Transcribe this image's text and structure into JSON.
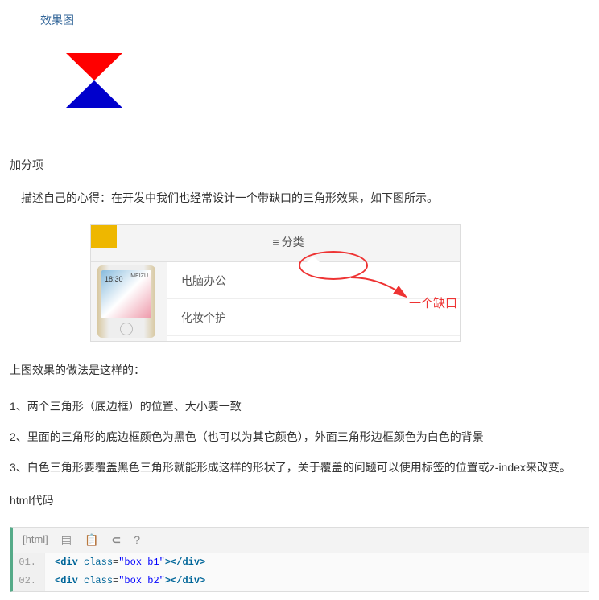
{
  "linkTitle": "效果图",
  "sectionHeading": "加分项",
  "intro": "描述自己的心得：在开发中我们也经常设计一个带缺口的三角形效果，如下图所示。",
  "illustration": {
    "hamburger": "≡",
    "hamLabel": "分类",
    "menuItems": [
      "电脑办公",
      "化妆个护"
    ],
    "notchLabel": "一个缺口",
    "phoneTime": "18:30",
    "phoneBrand": "MEIZU"
  },
  "howtoHeading": "上图效果的做法是这样的：",
  "steps": [
    "1、两个三角形（底边框）的位置、大小要一致",
    "2、里面的三角形的底边框颜色为黑色（也可以为其它颜色），外面三角形边框颜色为白色的背景",
    "3、白色三角形要覆盖黑色三角形就能形成这样的形状了，关于覆盖的问题可以使用标签的位置或z-index来改变。"
  ],
  "codeTitle": "html代码",
  "codeLang": "[html]",
  "toolbarIcons": {
    "view": "view-plain-icon",
    "copy": "copy-icon",
    "expand": "expand-icon",
    "help": "help-icon"
  },
  "codeLines": [
    {
      "num": "01.",
      "tokens": [
        "<div ",
        "class",
        "=",
        "\"box b1\"",
        "></div>"
      ]
    },
    {
      "num": "02.",
      "tokens": [
        "<div ",
        "class",
        "=",
        "\"box b2\"",
        "></div>"
      ]
    }
  ]
}
